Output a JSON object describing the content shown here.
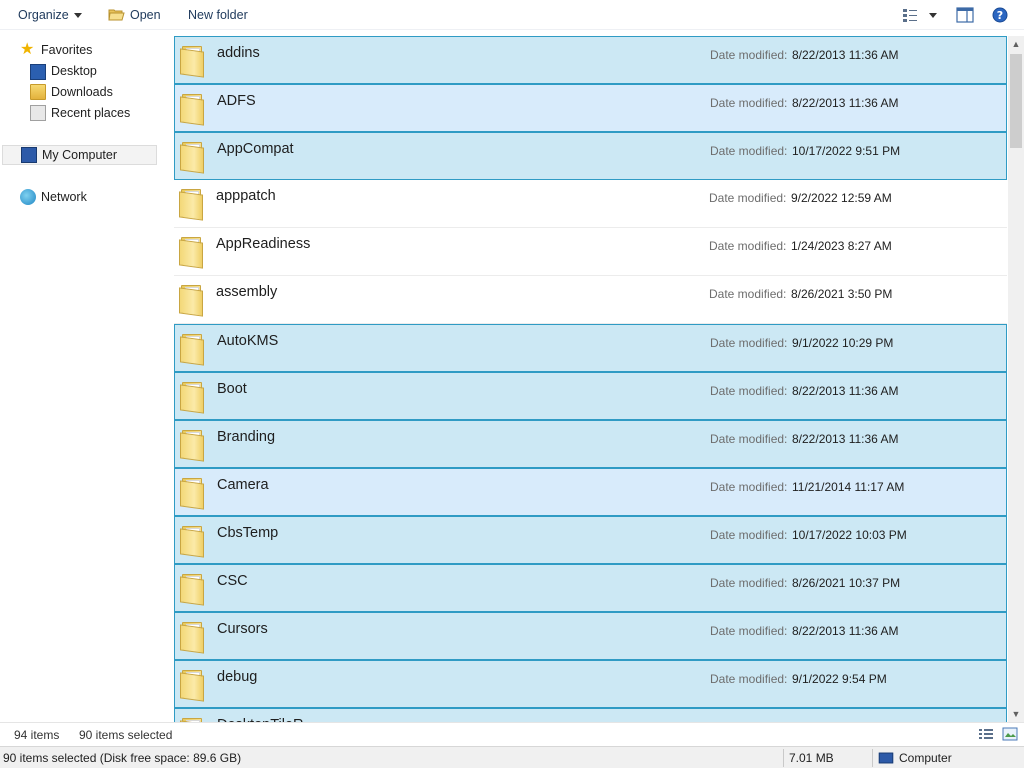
{
  "toolbar": {
    "organize_label": "Organize",
    "open_label": "Open",
    "new_folder_label": "New folder"
  },
  "nav": {
    "favorites": "Favorites",
    "desktop": "Desktop",
    "downloads": "Downloads",
    "recent_places": "Recent places",
    "computer": "My Computer",
    "network": "Network"
  },
  "files": {
    "date_label": "Date modified:",
    "rows": [
      {
        "name": "addins",
        "date": "8/22/2013 11:36 AM",
        "state": "selected"
      },
      {
        "name": "ADFS",
        "date": "8/22/2013 11:36 AM",
        "state": "selected-hot"
      },
      {
        "name": "AppCompat",
        "date": "10/17/2022 9:51 PM",
        "state": "selected"
      },
      {
        "name": "apppatch",
        "date": "9/2/2022 12:59 AM",
        "state": "plain"
      },
      {
        "name": "AppReadiness",
        "date": "1/24/2023 8:27 AM",
        "state": "plain"
      },
      {
        "name": "assembly",
        "date": "8/26/2021 3:50 PM",
        "state": "plain"
      },
      {
        "name": "AutoKMS",
        "date": "9/1/2022 10:29 PM",
        "state": "selected"
      },
      {
        "name": "Boot",
        "date": "8/22/2013 11:36 AM",
        "state": "selected"
      },
      {
        "name": "Branding",
        "date": "8/22/2013 11:36 AM",
        "state": "selected"
      },
      {
        "name": "Camera",
        "date": "11/21/2014 11:17 AM",
        "state": "selected-hot"
      },
      {
        "name": "CbsTemp",
        "date": "10/17/2022 10:03 PM",
        "state": "selected"
      },
      {
        "name": "CSC",
        "date": "8/26/2021 10:37 PM",
        "state": "selected"
      },
      {
        "name": "Cursors",
        "date": "8/22/2013 11:36 AM",
        "state": "selected"
      },
      {
        "name": "debug",
        "date": "9/1/2022 9:54 PM",
        "state": "selected"
      },
      {
        "name": "DesktopTileR...",
        "date": "",
        "state": "selected"
      }
    ]
  },
  "details": {
    "item_count": "94 items",
    "selected_count": "90 items selected"
  },
  "status": {
    "selection": "90 items selected (Disk free space: 89.6 GB)",
    "size": "7.01 MB",
    "location": "Computer"
  },
  "colors": {
    "selected_bg": "#cce8f4",
    "selected_hot_bg": "#d8ebfb",
    "selected_border": "#2f9bc4",
    "folder_yellow": "#f3d878"
  },
  "icons": {
    "favorites": "star-icon",
    "desktop": "desktop-icon",
    "downloads": "downloads-folder-icon",
    "recent": "recent-places-icon",
    "computer": "computer-icon",
    "network": "network-icon",
    "folder": "folder-icon"
  }
}
